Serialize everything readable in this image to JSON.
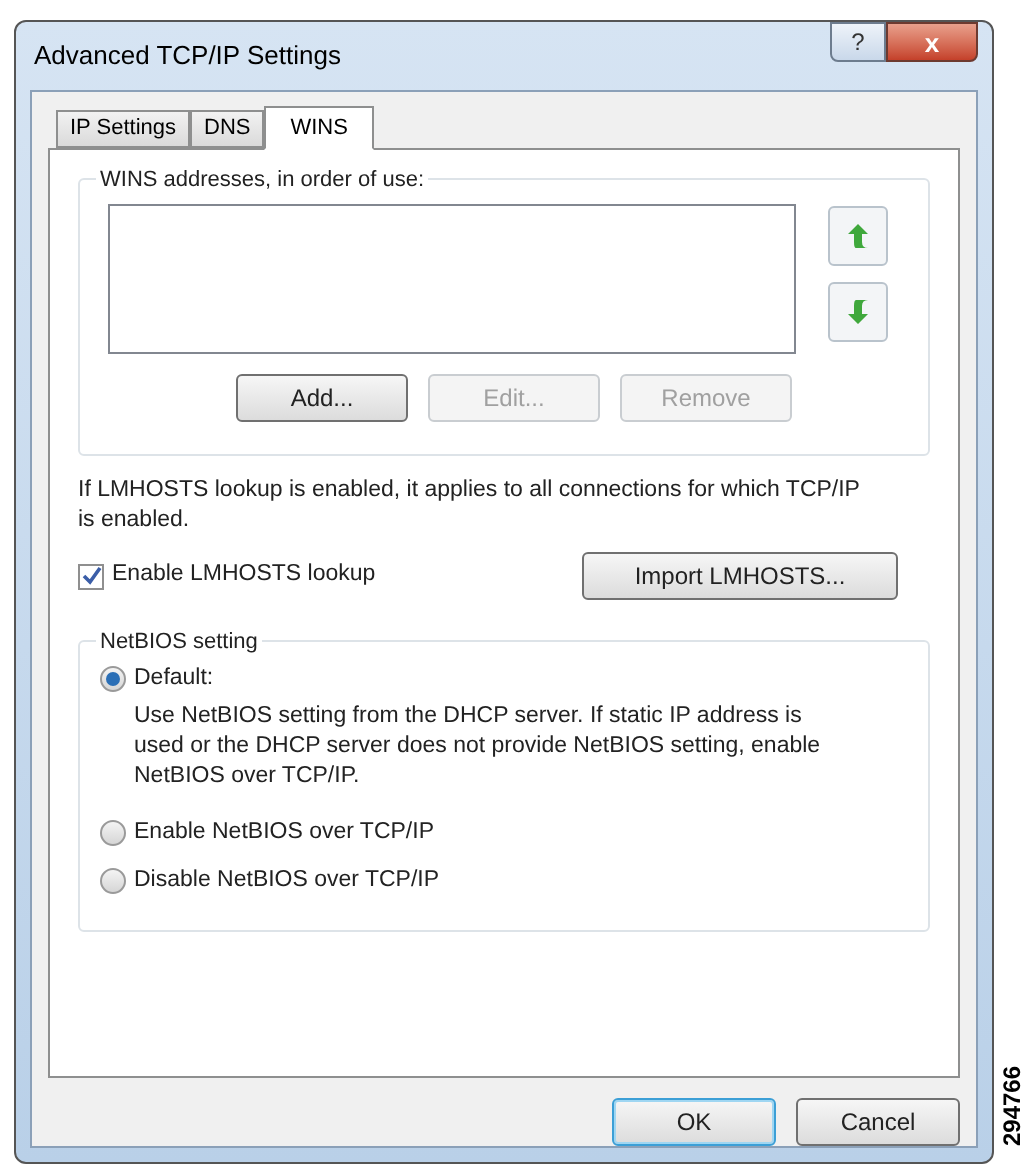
{
  "window": {
    "title": "Advanced TCP/IP Settings",
    "help_button": "?",
    "close_button": "x"
  },
  "tabs": [
    {
      "label": "IP Settings",
      "selected": false
    },
    {
      "label": "DNS",
      "selected": false
    },
    {
      "label": "WINS",
      "selected": true
    }
  ],
  "wins_group": {
    "title": "WINS addresses, in order of use:",
    "buttons": [
      {
        "label": "Add...",
        "disabled": false
      },
      {
        "label": "Edit...",
        "disabled": true
      },
      {
        "label": "Remove",
        "disabled": true
      }
    ]
  },
  "lmhosts_note": "If LMHOSTS lookup is enabled, it applies to all connections for which TCP/IP is enabled.",
  "lmhosts_checkbox": {
    "label": "Enable LMHOSTS lookup",
    "checked": true
  },
  "import_button": "Import LMHOSTS...",
  "netbios_group": {
    "title": "NetBIOS setting",
    "options": [
      {
        "label": "Default:",
        "selected": true,
        "description": "Use NetBIOS setting from the DHCP server. If static IP address is used or the DHCP server does not provide NetBIOS setting, enable NetBIOS over TCP/IP."
      },
      {
        "label": "Enable NetBIOS over TCP/IP",
        "selected": false
      },
      {
        "label": "Disable NetBIOS over TCP/IP",
        "selected": false
      }
    ]
  },
  "footer_buttons": [
    {
      "label": "OK",
      "default": true
    },
    {
      "label": "Cancel",
      "default": false
    }
  ],
  "figure_number": "294766"
}
